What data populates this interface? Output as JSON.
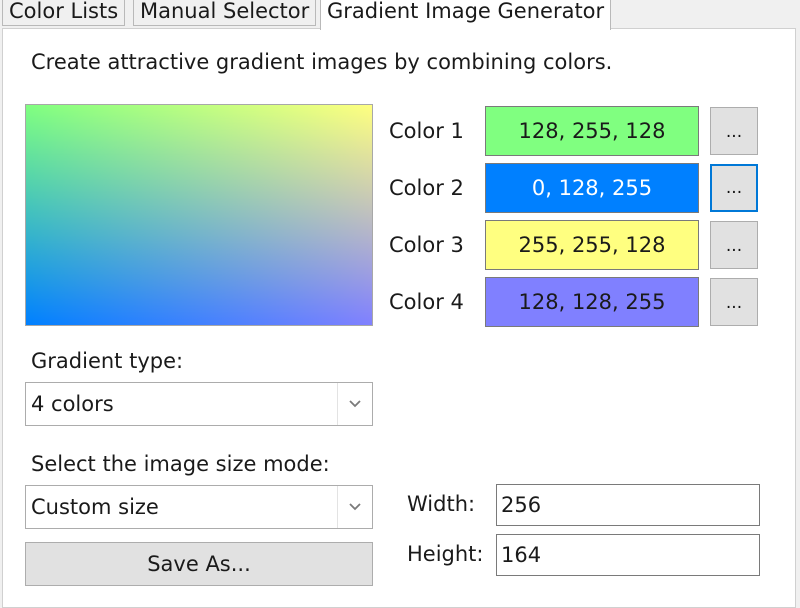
{
  "tabs": [
    {
      "label": "Color Lists"
    },
    {
      "label": "Manual Selector"
    },
    {
      "label": "Gradient Image Generator"
    }
  ],
  "description": "Create attractive gradient images by combining colors.",
  "colors": [
    {
      "label": "Color 1",
      "value": "128, 255, 128",
      "hex": "#80ff80",
      "text_color": "#1a1a1a"
    },
    {
      "label": "Color 2",
      "value": "0, 128, 255",
      "hex": "#0080ff",
      "text_color": "#ffffff"
    },
    {
      "label": "Color 3",
      "value": "255, 255, 128",
      "hex": "#ffff80",
      "text_color": "#1a1a1a"
    },
    {
      "label": "Color 4",
      "value": "128, 128, 255",
      "hex": "#8080ff",
      "text_color": "#1a1a1a"
    }
  ],
  "picker_label": "...",
  "gradient_type": {
    "label": "Gradient type:",
    "selected": "4 colors"
  },
  "size_mode": {
    "label": "Select the image size mode:",
    "selected": "Custom size"
  },
  "save_button": "Save As...",
  "width": {
    "label": "Width:",
    "value": "256"
  },
  "height": {
    "label": "Height:",
    "value": "164"
  }
}
